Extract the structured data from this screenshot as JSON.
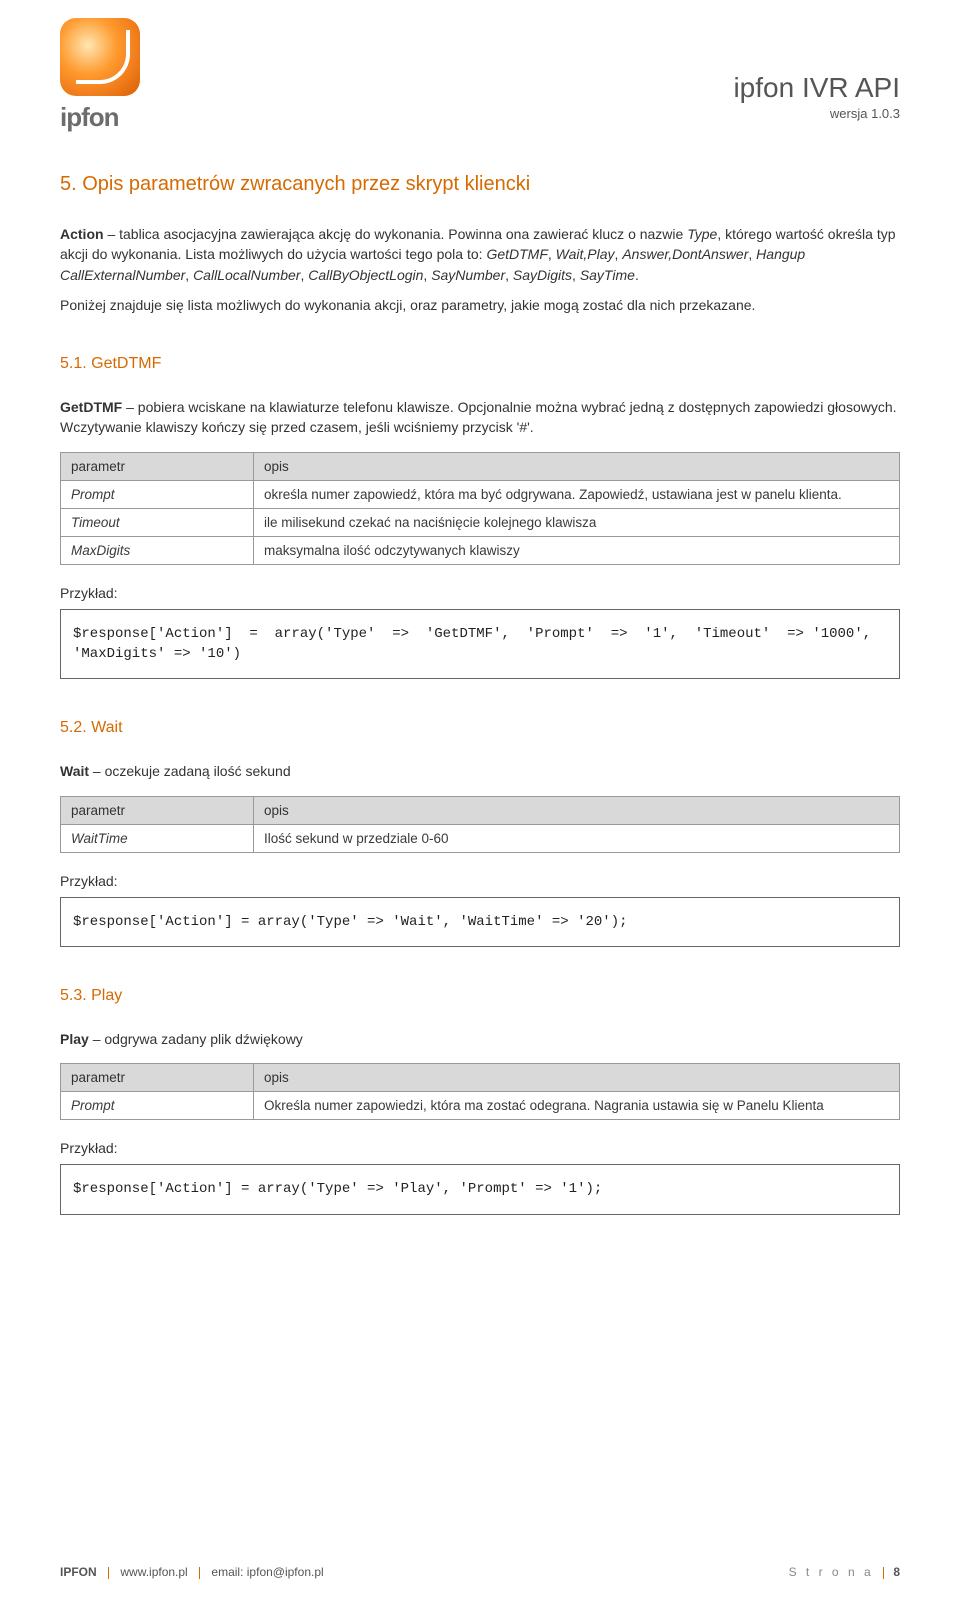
{
  "header": {
    "brand": "ipfon",
    "doc_title": "ipfon IVR API",
    "doc_version": "wersja 1.0.3"
  },
  "section5": {
    "title": "5.   Opis parametrów zwracanych przez skrypt kliencki",
    "p1_a": "Action",
    "p1_b": " – tablica asocjacyjna zawierająca akcję do wykonania. Powinna ona zawierać klucz o nazwie ",
    "p1_c": "Type",
    "p1_d": ", którego wartość określa typ akcji do wykonania. Lista możliwych do użycia wartości tego pola to: ",
    "p1_e": "GetDTMF",
    "p1_f": ", ",
    "p1_g": "Wait,Play",
    "p1_h": ", ",
    "p1_i": "Answer,DontAnswer",
    "p1_j": ", ",
    "p1_k": "Hangup CallExternalNumber",
    "p1_l": ", ",
    "p1_m": "CallLocalNumber",
    "p1_n": ", ",
    "p1_o": "CallByObjectLogin",
    "p1_p": ", ",
    "p1_q": "SayNumber",
    "p1_r": ", ",
    "p1_s": "SayDigits",
    "p1_t": ", ",
    "p1_u": "SayTime",
    "p1_v": ".",
    "p2": "Poniżej znajduje się lista możliwych do wykonania akcji, oraz parametry, jakie mogą zostać dla nich przekazane."
  },
  "sec51": {
    "title": "5.1.    GetDTMF",
    "p_a": "GetDTMF",
    "p_b": " – pobiera wciskane na klawiaturze telefonu klawisze. Opcjonalnie można wybrać jedną z dostępnych zapowiedzi głosowych. Wczytywanie klawiszy kończy się przed czasem, jeśli wciśniemy przycisk '#'.",
    "table": {
      "h1": "parametr",
      "h2": "opis",
      "rows": [
        {
          "p": "Prompt",
          "d": "określa numer zapowiedź, która ma być odgrywana. Zapowiedź, ustawiana jest w panelu klienta."
        },
        {
          "p": "Timeout",
          "d": "ile milisekund czekać na naciśnięcie kolejnego klawisza"
        },
        {
          "p": "MaxDigits",
          "d": "maksymalna ilość odczytywanych klawiszy"
        }
      ]
    },
    "example_label": "Przykład:",
    "example_code": "$response['Action']  =  array('Type'  =>  'GetDTMF',  'Prompt'  =>  '1',  'Timeout'  => '1000', 'MaxDigits' => '10')"
  },
  "sec52": {
    "title": "5.2.    Wait",
    "p_a": "Wait",
    "p_b": " – oczekuje zadaną ilość sekund",
    "table": {
      "h1": "parametr",
      "h2": "opis",
      "rows": [
        {
          "p": "WaitTime",
          "d": "Ilość sekund w przedziale 0-60"
        }
      ]
    },
    "example_label": "Przykład:",
    "example_code": "$response['Action'] = array('Type' => 'Wait', 'WaitTime' => '20');"
  },
  "sec53": {
    "title": "5.3.    Play",
    "p_a": "Play",
    "p_b": " – odgrywa zadany plik dźwiękowy",
    "table": {
      "h1": "parametr",
      "h2": "opis",
      "rows": [
        {
          "p": "Prompt",
          "d": "Określa numer zapowiedzi, która ma zostać odegrana. Nagrania ustawia się w Panelu Klienta"
        }
      ]
    },
    "example_label": "Przykład:",
    "example_code": "$response['Action'] = array('Type' => 'Play', 'Prompt' => '1');"
  },
  "footer": {
    "company": "IPFON",
    "url": "www.ipfon.pl",
    "email": "email: ipfon@ipfon.pl",
    "page_label": "S t r o n a",
    "page_number": "8"
  }
}
